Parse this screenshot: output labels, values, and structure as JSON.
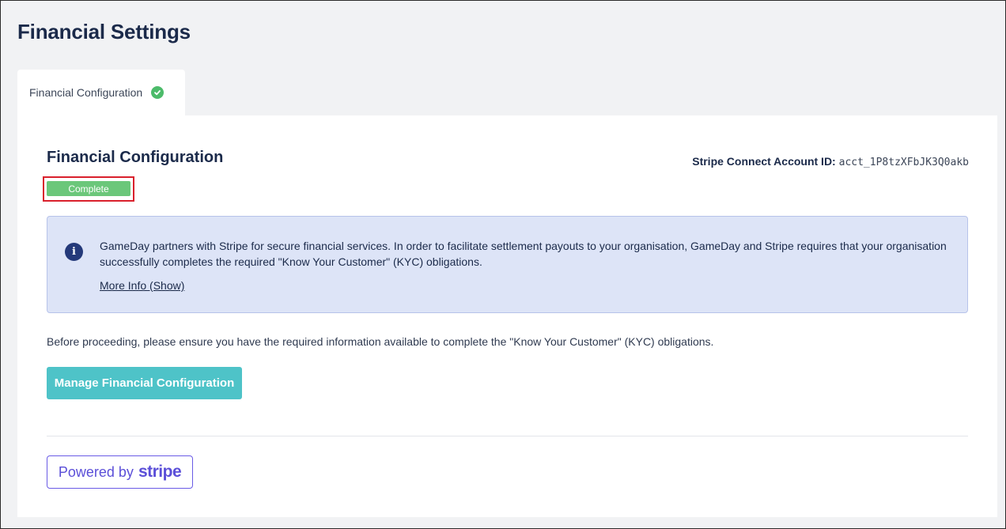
{
  "page": {
    "title": "Financial Settings"
  },
  "tabs": [
    {
      "label": "Financial Configuration",
      "status_icon": "check-circle-icon"
    }
  ],
  "section": {
    "title": "Financial Configuration",
    "status_badge": "Complete",
    "stripe_id_label": "Stripe Connect Account ID:",
    "stripe_id_value": "acct_1P8tzXFbJK3Q0akb"
  },
  "info": {
    "icon": "info-icon",
    "icon_glyph": "i",
    "text": "GameDay partners with Stripe for secure financial services. In order to facilitate settlement payouts to your organisation, GameDay and Stripe requires that your organisation successfully completes the required \"Know Your Customer\" (KYC) obligations.",
    "more_link": "More Info (Show)"
  },
  "note": "Before proceeding, please ensure you have the required information available to complete the \"Know Your Customer\" (KYC) obligations.",
  "actions": {
    "manage_label": "Manage Financial Configuration"
  },
  "powered_by": {
    "prefix": "Powered by",
    "brand": "stripe"
  },
  "colors": {
    "badge_green": "#6bc77a",
    "button_teal": "#4ec3c8",
    "info_bg": "#dde4f7",
    "stripe_purple": "#5b4fd8",
    "highlight_red": "#d9202c"
  }
}
